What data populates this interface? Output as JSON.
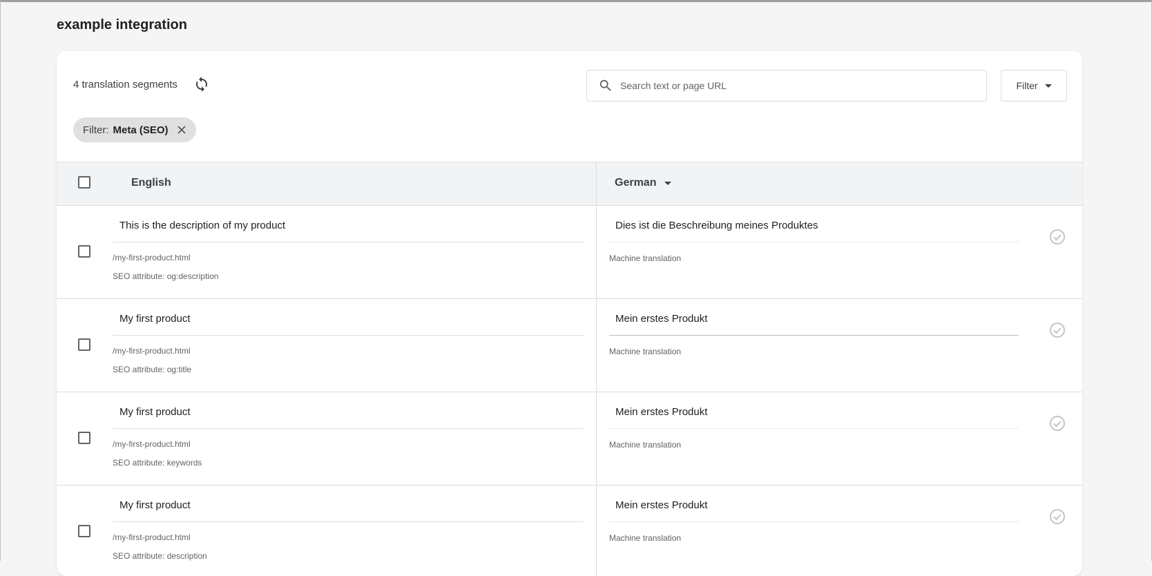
{
  "page": {
    "title": "example integration"
  },
  "toolbar": {
    "segment_count": "4 translation segments",
    "search_placeholder": "Search text or page URL",
    "filter_label": "Filter"
  },
  "active_filter": {
    "prefix": "Filter:",
    "value": "Meta (SEO)"
  },
  "table": {
    "source_language": "English",
    "target_language": "German",
    "rows": [
      {
        "source": "This is the description of my product",
        "path": "/my-first-product.html",
        "attribute": "SEO attribute: og:description",
        "target": "Dies ist die Beschreibung meines Produktes",
        "target_source": "Machine translation"
      },
      {
        "source": "My first product",
        "path": "/my-first-product.html",
        "attribute": "SEO attribute: og:title",
        "target": "Mein erstes Produkt",
        "target_source": "Machine translation"
      },
      {
        "source": "My first product",
        "path": "/my-first-product.html",
        "attribute": "SEO attribute: keywords",
        "target": "Mein erstes Produkt",
        "target_source": "Machine translation"
      },
      {
        "source": "My first product",
        "path": "/my-first-product.html",
        "attribute": "SEO attribute: description",
        "target": "Mein erstes Produkt",
        "target_source": "Machine translation"
      }
    ]
  },
  "colors": {
    "background": "#f5f5f5",
    "card": "#ffffff",
    "header_row": "#f1f3f4",
    "chip": "#e0e0e0",
    "divider": "#dadce0",
    "approve_icon": "#c4c4c4"
  },
  "icons": {
    "refresh": "refresh-icon",
    "search": "search-icon",
    "filter_caret": "caret-down-icon",
    "chip_close": "close-icon",
    "approve": "check-circle-icon"
  }
}
